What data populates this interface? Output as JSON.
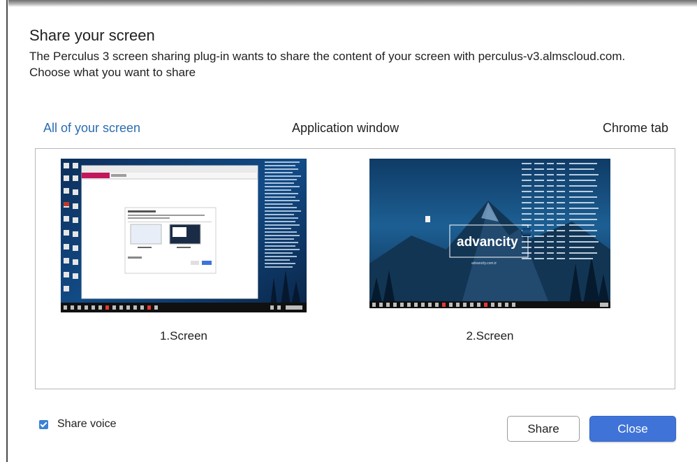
{
  "dialog": {
    "title": "Share your screen",
    "description_line1": "The Perculus 3 screen sharing plug-in wants to share the content of your screen with perculus-v3.almscloud.com.",
    "description_line2": "Choose what you want to share"
  },
  "tabs": [
    {
      "label": "All of your screen",
      "active": true
    },
    {
      "label": "Application window",
      "active": false
    },
    {
      "label": "Chrome tab",
      "active": false
    }
  ],
  "screens": [
    {
      "label": "1.Screen"
    },
    {
      "label": "2.Screen",
      "logo_text": "advancity",
      "logo_subtext": "advancity.com.tr"
    }
  ],
  "footer": {
    "share_voice_label": "Share voice",
    "share_voice_checked": true,
    "share_button": "Share",
    "close_button": "Close"
  },
  "colors": {
    "accent": "#2b6cb0",
    "close_button": "#3f73d8",
    "checkbox": "#3b82d6"
  }
}
